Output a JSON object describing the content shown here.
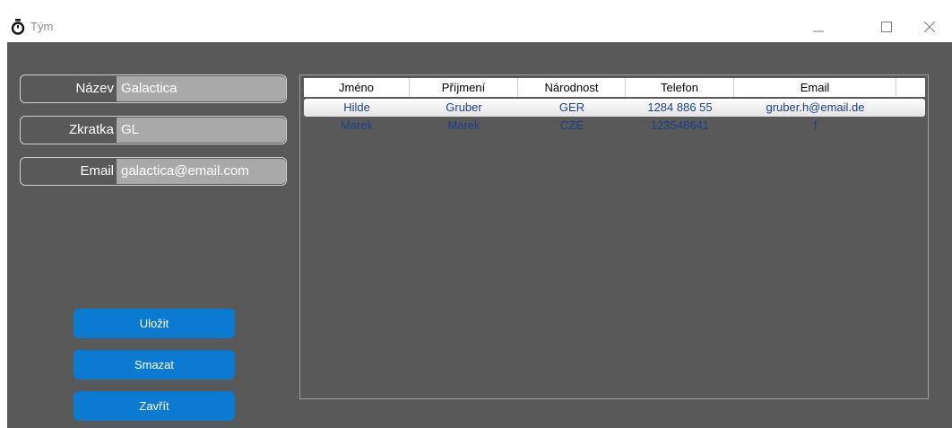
{
  "window": {
    "title": "Tým",
    "icon": "stopwatch-icon",
    "controls": [
      "minimize-icon",
      "maximize-icon",
      "close-icon"
    ]
  },
  "form": {
    "name_label": "Název",
    "name_value": "Galactica",
    "abbr_label": "Zkratka",
    "abbr_value": "GL",
    "email_label": "Email",
    "email_value": "galactica@email.com"
  },
  "buttons": {
    "save": "Uložit",
    "delete": "Smazat",
    "close": "Zavřít"
  },
  "grid": {
    "columns": [
      "Jméno",
      "Příjmení",
      "Národnost",
      "Telefon",
      "Email"
    ],
    "rows": [
      [
        "Hilde",
        "Gruber",
        "GER",
        "1284 886 55",
        "gruber.h@email.de"
      ],
      [
        "Marek",
        "Marek",
        "CZE",
        "123548641",
        "f"
      ]
    ]
  },
  "colors": {
    "background": "#595959",
    "input": "#a9a9a9",
    "button": "#0a7bd1",
    "row_text": "#1a3f8a"
  }
}
